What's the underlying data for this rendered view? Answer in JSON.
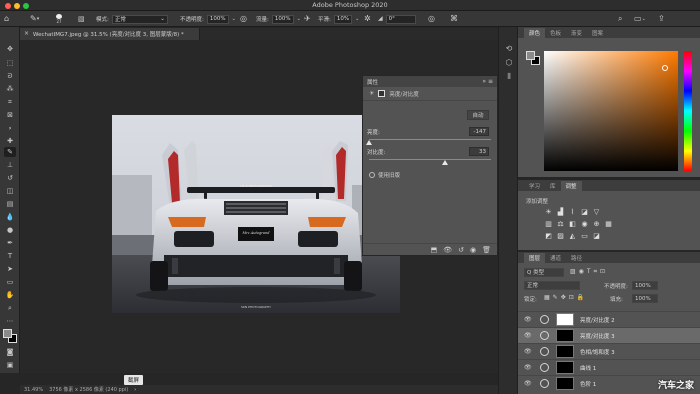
{
  "window": {
    "title": "Adobe Photoshop 2020"
  },
  "options_bar": {
    "brush_size": "27",
    "mode_label": "模式:",
    "mode_value": "正常",
    "opacity_label": "不透明度:",
    "opacity_value": "100%",
    "flow_label": "流量:",
    "flow_value": "100%",
    "smoothing_label": "平滑:",
    "smoothing_value": "10%",
    "angle_value": "0°"
  },
  "document": {
    "tab_label": "WechatIMG7.jpeg @ 31.5% (亮度/对比度 3, 图层蒙版/8) *",
    "zoom": "31.49%",
    "dimensions": "3756 像素 x 2586 像素 (240 ppi)",
    "tooltip": "截屏"
  },
  "photo": {
    "plate_text": "Mrz Autogrand",
    "caption": "SKN PHOTOGRAPHY",
    "wing_text": "LB ★ PERFORMANCE"
  },
  "properties": {
    "title": "属性",
    "subtitle": "亮度/对比度",
    "auto_button": "自动",
    "brightness_label": "亮度:",
    "brightness_value": "-147",
    "brightness_fraction": 0.0,
    "contrast_label": "对比度:",
    "contrast_value": "33",
    "contrast_fraction": 0.62,
    "legacy_label": "使用旧版"
  },
  "color_panel": {
    "tabs": [
      "颜色",
      "色板",
      "渐变",
      "图案"
    ],
    "fg_color": "#8a8a8a",
    "bg_color": "#000000"
  },
  "learn_panel": {
    "tabs": [
      "学习",
      "库",
      "调整"
    ],
    "add_adjustment": "添加调整"
  },
  "layers_panel": {
    "tabs": [
      "图层",
      "通道",
      "路径"
    ],
    "filter_label": "Q 类型",
    "blend_mode": "正常",
    "opacity_label": "不透明度:",
    "opacity_value": "100%",
    "lock_label": "锁定:",
    "fill_label": "填充:",
    "fill_value": "100%",
    "layers": [
      {
        "name": "亮度/对比度 2",
        "selected": false
      },
      {
        "name": "亮度/对比度 3",
        "selected": true
      },
      {
        "name": "色相/饱和度 3",
        "selected": false
      },
      {
        "name": "曲线 1",
        "selected": false
      },
      {
        "name": "色阶 1",
        "selected": false
      }
    ]
  },
  "watermark": "汽车之家"
}
